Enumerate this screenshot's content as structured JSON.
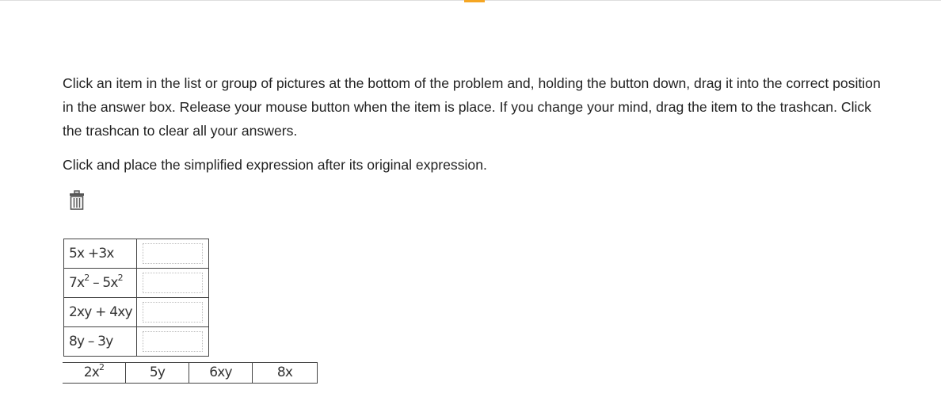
{
  "instructions": "Click an item in the list or group of pictures at the bottom of the problem and, holding the button down, drag it into the correct position in the answer box. Release your mouse button when the item is place. If you change your mind, drag the item to the trashcan. Click the trashcan to clear all your answers.",
  "prompt": "Click and place the simplified expression after its original expression.",
  "trash_icon": "trash-icon",
  "rows": [
    {
      "base": "5x +3x",
      "sup1": "",
      "mid": "",
      "sup2": ""
    },
    {
      "base": "7x",
      "sup1": "2",
      "mid": " – 5x",
      "sup2": "2"
    },
    {
      "base": "2xy + 4xy",
      "sup1": "",
      "mid": "",
      "sup2": ""
    },
    {
      "base": "8y – 3y",
      "sup1": "",
      "mid": "",
      "sup2": ""
    }
  ],
  "choices": [
    {
      "base": "2x",
      "sup": "2"
    },
    {
      "base": "5y",
      "sup": ""
    },
    {
      "base": "6xy",
      "sup": ""
    },
    {
      "base": "8x",
      "sup": ""
    }
  ],
  "colors": {
    "accent": "#f5a623",
    "border": "#444444"
  }
}
